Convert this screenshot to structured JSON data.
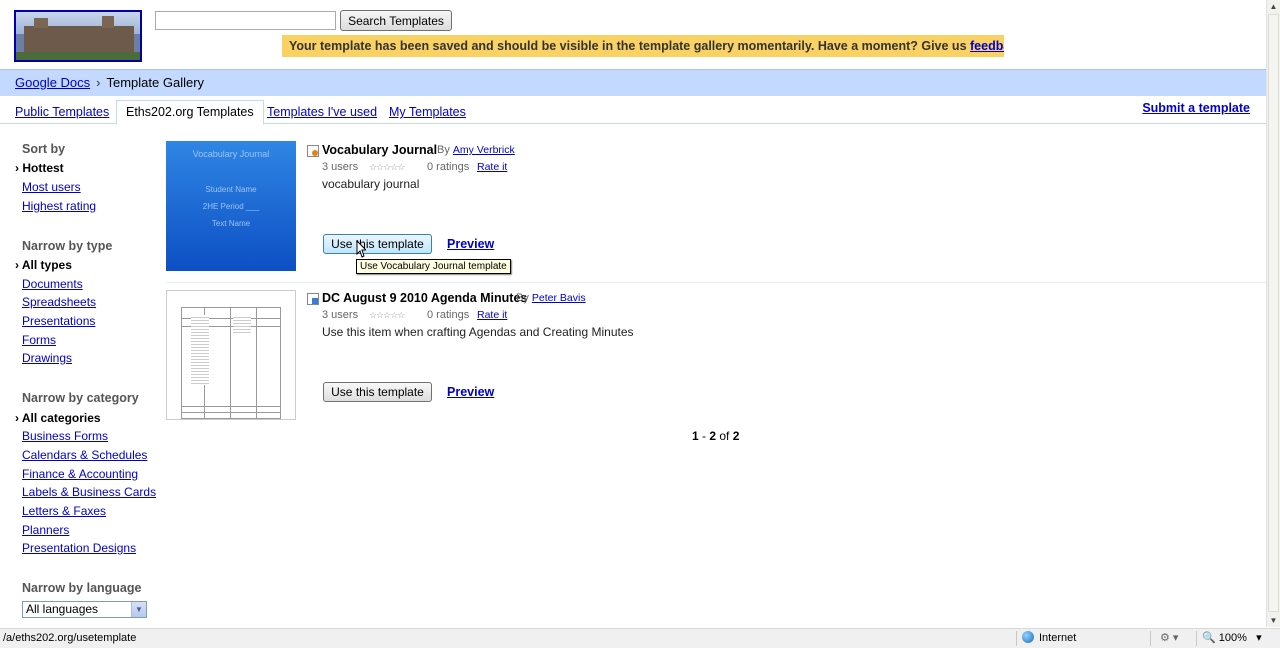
{
  "search": {
    "placeholder": "",
    "button_label": "Search Templates"
  },
  "notice": {
    "text": "Your template has been saved and should be visible in the template gallery momentarily. Have a moment? Give us ",
    "link": "feedback",
    "end": "."
  },
  "breadcrumb": {
    "home": "Google Docs",
    "separator": "›",
    "current": "Template Gallery"
  },
  "tabs": [
    {
      "label": "Public Templates",
      "active": false
    },
    {
      "label": "Eths202.org Templates",
      "active": true
    },
    {
      "label": "Templates I've used",
      "active": false
    },
    {
      "label": "My Templates",
      "active": false
    }
  ],
  "submit_link": "Submit a template",
  "sidebar": {
    "sort_heading": "Sort by",
    "sort": [
      "Hottest",
      "Most users",
      "Highest rating"
    ],
    "type_heading": "Narrow by type",
    "types": [
      "All types",
      "Documents",
      "Spreadsheets",
      "Presentations",
      "Forms",
      "Drawings"
    ],
    "category_heading": "Narrow by category",
    "categories": [
      "All categories",
      "Business Forms",
      "Calendars & Schedules",
      "Finance & Accounting",
      "Labels & Business Cards",
      "Letters & Faxes",
      "Planners",
      "Presentation Designs"
    ],
    "language_heading": "Narrow by language",
    "language_value": "All languages"
  },
  "templates": [
    {
      "title": "Vocabulary Journal",
      "by": "By",
      "author": "Amy Verbrick",
      "users": "3 users",
      "stars": "☆☆☆☆☆",
      "ratings": "0 ratings",
      "rate": "Rate it",
      "description": "vocabulary journal",
      "use_label": "Use this template",
      "preview": "Preview",
      "thumb_lines": [
        "Vocabulary Journal",
        "Student Name",
        "2HE Period ___",
        "Text Name"
      ]
    },
    {
      "title": "DC August 9 2010 Agenda Minutes",
      "by": "By",
      "author": "Peter Bavis",
      "users": "3 users",
      "stars": "☆☆☆☆☆",
      "ratings": "0 ratings",
      "rate": "Rate it",
      "description": "Use this item when crafting Agendas and Creating Minutes",
      "use_label": "Use this template",
      "preview": "Preview"
    }
  ],
  "tooltip": "Use Vocabulary Journal template",
  "pager": {
    "start": "1",
    "dash": " - ",
    "end": "2",
    "of": " of ",
    "total": "2"
  },
  "statusbar": {
    "url": "/a/eths202.org/usetemplate",
    "zone": "Internet",
    "zoom": "100%",
    "zoom_arrow": "▾",
    "protected_arrow": "▾"
  },
  "scrollbar": {
    "up": "▲",
    "down": "▼"
  },
  "colors": {
    "breadcrumb_bar": "#c3d9ff",
    "notice": "#fad163",
    "link": "#0000cc"
  }
}
